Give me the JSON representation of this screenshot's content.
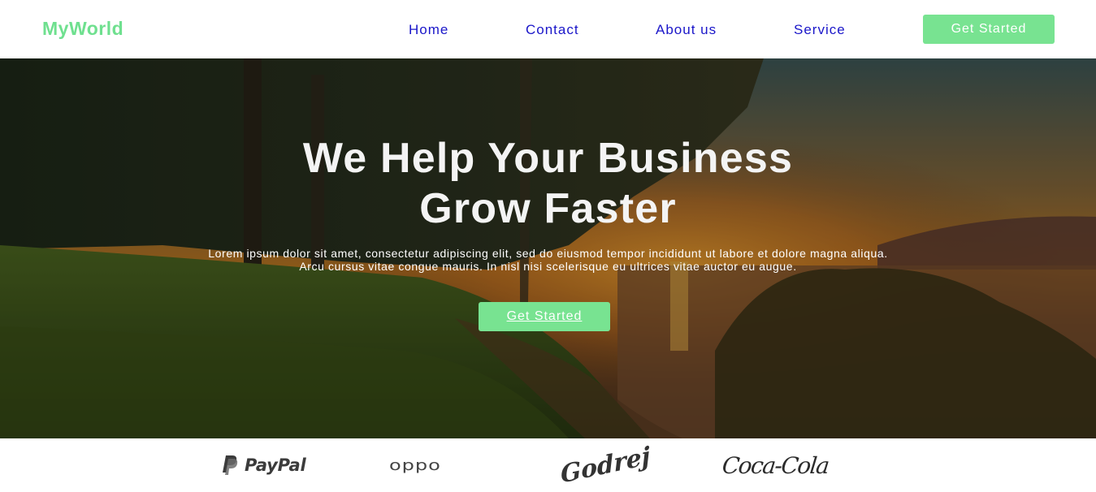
{
  "header": {
    "logo": "MyWorld",
    "nav": [
      {
        "label": "Home"
      },
      {
        "label": "Contact"
      },
      {
        "label": "About us"
      },
      {
        "label": "Service"
      }
    ],
    "cta_label": "Get Started"
  },
  "hero": {
    "title_line1": "We Help Your Business",
    "title_line2": "Grow Faster",
    "text_line1": "Lorem ipsum dolor sit amet, consectetur adipiscing elit, sed do eiusmod tempor incididunt ut labore et dolore magna aliqua.",
    "text_line2": "Arcu cursus vitae congue mauris. In nisl nisi scelerisque eu ultrices vitae auctor eu augue.",
    "cta_label": "Get Started",
    "background": "landscape photo: trees, grass and lake at sunset"
  },
  "brands": [
    {
      "name": "PayPal",
      "icon": "paypal-logo"
    },
    {
      "name": "oppo",
      "icon": "oppo-logo"
    },
    {
      "name": "Godrej",
      "icon": "godrej-logo"
    },
    {
      "name": "Coca-Cola",
      "icon": "coca-cola-logo"
    }
  ],
  "colors": {
    "accent": "#78e391",
    "logo": "#6fe08f",
    "nav_link": "#1a16c9",
    "hero_text": "#ffffff"
  }
}
